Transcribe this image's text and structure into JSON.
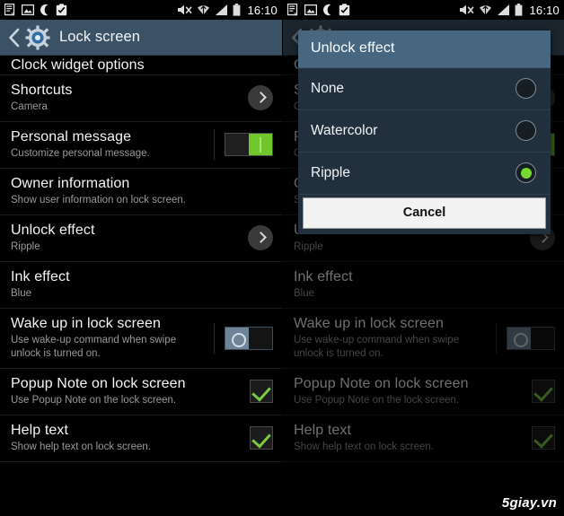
{
  "status_bar": {
    "time": "16:10",
    "left_icons": [
      "screenshot-capture-icon",
      "image-icon",
      "moon-crescent-icon",
      "task-checklist-icon"
    ],
    "right_icons": [
      "mute-icon",
      "wifi-icon",
      "signal-icon",
      "battery-icon"
    ]
  },
  "action_bar": {
    "back_label": "back-arrow",
    "icon": "settings-gear-icon",
    "title": "Lock screen"
  },
  "settings_rows": [
    {
      "title": "Clock widget options",
      "sub": "",
      "control": "none",
      "clipped": true
    },
    {
      "title": "Shortcuts",
      "sub": "Camera",
      "control": "chevron"
    },
    {
      "title": "Personal message",
      "sub": "Customize personal message.",
      "control": "toggle-on"
    },
    {
      "title": "Owner information",
      "sub": "Show user information on lock screen.",
      "control": "none"
    },
    {
      "title": "Unlock effect",
      "sub": "Ripple",
      "control": "chevron"
    },
    {
      "title": "Ink effect",
      "sub": "Blue",
      "control": "none"
    },
    {
      "title": "Wake up in lock screen",
      "sub": "Use wake-up command when swipe unlock is turned on.",
      "control": "toggle-off"
    },
    {
      "title": "Popup Note on lock screen",
      "sub": "Use Popup Note on the lock screen.",
      "control": "checkbox-checked"
    },
    {
      "title": "Help text",
      "sub": "Show help text on lock screen.",
      "control": "checkbox-checked"
    }
  ],
  "dialog": {
    "title": "Unlock effect",
    "options": [
      {
        "label": "None",
        "selected": false
      },
      {
        "label": "Watercolor",
        "selected": false
      },
      {
        "label": "Ripple",
        "selected": true
      }
    ],
    "cancel_label": "Cancel"
  },
  "watermark": {
    "text": "5giay.vn"
  },
  "colors": {
    "action_bar": "#3b5266",
    "dialog_title": "#476780",
    "dialog_body": "#22303d",
    "accent_green": "#76d830",
    "toggle_on": "#6fc72b",
    "background": "#000000"
  }
}
